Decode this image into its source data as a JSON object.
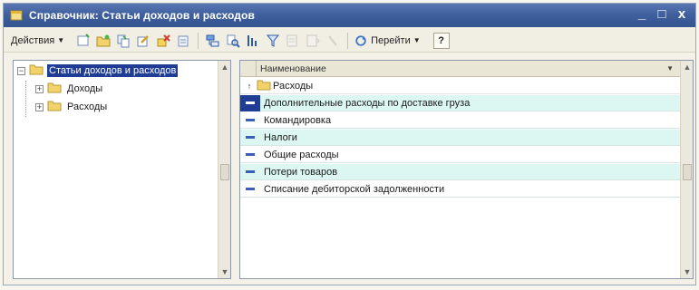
{
  "window": {
    "title": "Справочник: Статьи доходов и расходов",
    "buttons": [
      "_",
      "□",
      "x"
    ]
  },
  "toolbar": {
    "actions_label": "Действия",
    "goto_label": "Перейти",
    "help_label": "?",
    "icons": [
      "add-item-icon",
      "add-folder-icon",
      "copy-icon",
      "edit-icon",
      "delete-icon",
      "mark-deletion-icon",
      "hierarchy-icon",
      "find-icon",
      "search-in-list-icon",
      "filter-icon",
      "filter-off-icon",
      "sort-icon",
      "refresh-icon"
    ]
  },
  "tree": {
    "root_label": "Статьи доходов и расходов",
    "children": [
      {
        "label": "Доходы"
      },
      {
        "label": "Расходы"
      }
    ]
  },
  "list": {
    "column_header": "Наименование",
    "parent_row": "Расходы",
    "rows": [
      {
        "name": "Дополнительные расходы по доставке груза"
      },
      {
        "name": "Командировка"
      },
      {
        "name": "Налоги"
      },
      {
        "name": "Общие расходы"
      },
      {
        "name": "Потери товаров"
      },
      {
        "name": "Списание дебиторской задолженности"
      }
    ]
  },
  "colors": {
    "title_bar": "#3f5f9e",
    "selection": "#1f3d95",
    "row_alt": "#dcf7f1",
    "folder": "#e9c34a"
  }
}
